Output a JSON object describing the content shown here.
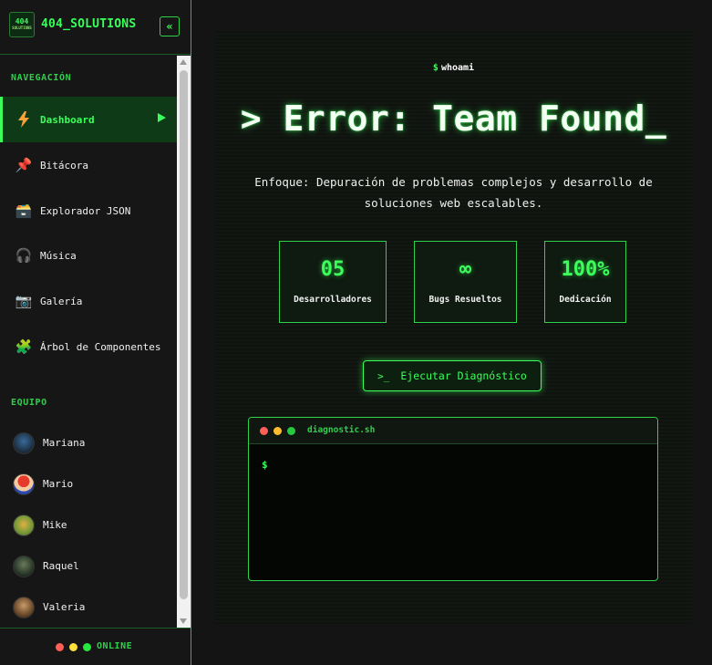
{
  "sidebar": {
    "logo_text": "404",
    "logo_subtext": "SOLUTIONS",
    "brand": "404_SOLUTIONS",
    "collapse_label": "«",
    "nav_section": "NAVEGACIÓN",
    "nav_items": [
      {
        "label": "Dashboard",
        "icon": "lightning-icon",
        "glyph": "⚡",
        "active": true
      },
      {
        "label": "Bitácora",
        "icon": "pushpin-icon",
        "glyph": "📌"
      },
      {
        "label": "Explorador JSON",
        "icon": "card-box-icon",
        "glyph": "🗃️"
      },
      {
        "label": "Música",
        "icon": "headphones-icon",
        "glyph": "🎧"
      },
      {
        "label": "Galería",
        "icon": "camera-icon",
        "glyph": "📷"
      },
      {
        "label": "Árbol de Componentes",
        "icon": "puzzle-icon",
        "glyph": "🧩"
      }
    ],
    "team_section": "EQUIPO",
    "team": [
      {
        "name": "Mariana"
      },
      {
        "name": "Mario"
      },
      {
        "name": "Mike"
      },
      {
        "name": "Raquel"
      },
      {
        "name": "Valeria"
      }
    ],
    "status": "ONLINE"
  },
  "main": {
    "whoami_symbol": "$",
    "whoami": "whoami",
    "headline": "> Error: Team Found_",
    "focus": "Enfoque: Depuración de problemas complejos y desarrollo de soluciones web escalables.",
    "stats": [
      {
        "value": "05",
        "label": "Desarrolladores"
      },
      {
        "value": "∞",
        "label": "Bugs Resueltos"
      },
      {
        "value": "100%",
        "label": "Dedicación"
      }
    ],
    "run_prompt": ">_",
    "run_label": "Ejecutar Diagnóstico",
    "terminal_title": "diagnostic.sh",
    "terminal_prompt": "$"
  },
  "colors": {
    "accent": "#3bff5a",
    "background": "#141414",
    "dot_red": "#ff5f56",
    "dot_yellow": "#ffbd2e",
    "dot_green": "#27c93f"
  }
}
